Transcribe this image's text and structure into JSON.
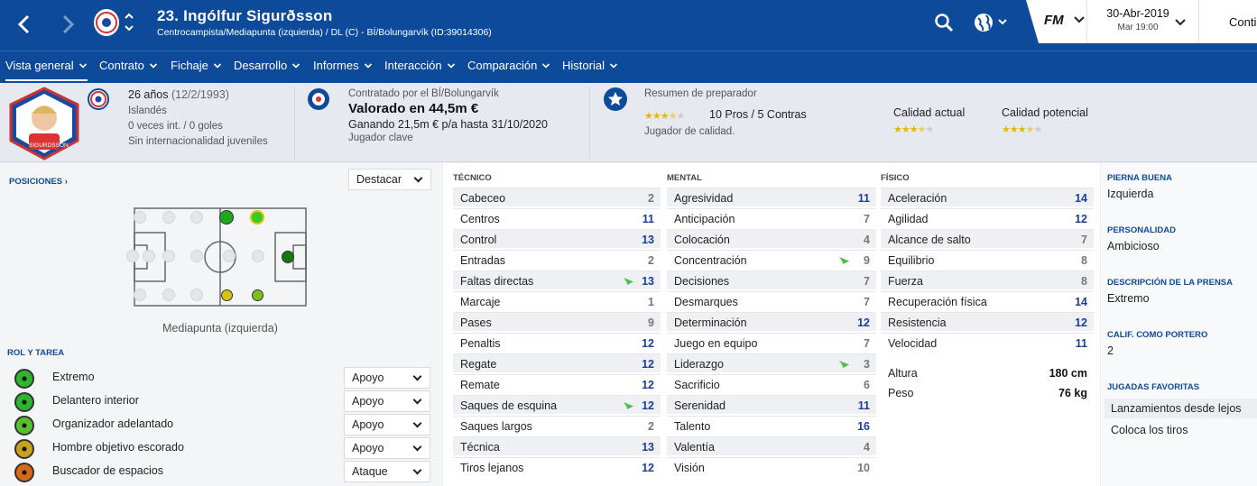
{
  "header": {
    "title": "23. Ingólfur Sigurðsson",
    "subtitle": "Centrocampista/Mediapunta (izquierda) / DL (C) - BÍ/Bolungarvík (ID:39014306)",
    "date": "30-Abr-2019",
    "time": "Mar 19:00",
    "fm": "FM",
    "continue": "Conti"
  },
  "menu": [
    "Vista general",
    "Contrato",
    "Fichaje",
    "Desarrollo",
    "Informes",
    "Interacción",
    "Comparación",
    "Historial"
  ],
  "info": {
    "age": "26 años",
    "dob": "(12/2/1993)",
    "nationality": "Islandés",
    "caps": "0 veces int. / 0 goles",
    "youth": "Sin internacionalidad juveniles",
    "contracted": "Contratado por el BÍ/Bolungarvík",
    "value": "Valorado en 44,5m €",
    "wage": "Ganando 21,5m € p/a hasta 31/10/2020",
    "status": "Jugador clave",
    "coach_title": "Resumen de preparador",
    "pros_cons": "10 Pros / 5 Contras",
    "coach_desc": "Jugador de calidad.",
    "current_ability": "Calidad actual",
    "potential_ability": "Calidad potencial",
    "photo_name": "SIGURDSSON"
  },
  "positions": {
    "title": "POSICIONES ›",
    "highlight": "Destacar",
    "selected": "Mediapunta (izquierda)"
  },
  "roles": {
    "title": "ROL Y TAREA",
    "items": [
      {
        "name": "Extremo",
        "duty": "Apoyo",
        "color": "#2db52d"
      },
      {
        "name": "Delantero interior",
        "duty": "Apoyo",
        "color": "#2db52d"
      },
      {
        "name": "Organizador adelantado",
        "duty": "Apoyo",
        "color": "#56c12a"
      },
      {
        "name": "Hombre objetivo escorado",
        "duty": "Apoyo",
        "color": "#c9a21a"
      },
      {
        "name": "Buscador de espacios",
        "duty": "Ataque",
        "color": "#d46a1a"
      }
    ]
  },
  "attributes": {
    "tecnico": {
      "title": "TÉCNICO",
      "items": [
        [
          "Cabeceo",
          2,
          ""
        ],
        [
          "Centros",
          11,
          ""
        ],
        [
          "Control",
          13,
          ""
        ],
        [
          "Entradas",
          2,
          ""
        ],
        [
          "Faltas directas",
          13,
          "up"
        ],
        [
          "Marcaje",
          1,
          ""
        ],
        [
          "Pases",
          9,
          ""
        ],
        [
          "Penaltis",
          12,
          ""
        ],
        [
          "Regate",
          12,
          ""
        ],
        [
          "Remate",
          12,
          ""
        ],
        [
          "Saques de esquina",
          12,
          "up"
        ],
        [
          "Saques largos",
          2,
          ""
        ],
        [
          "Técnica",
          13,
          ""
        ],
        [
          "Tiros lejanos",
          12,
          ""
        ]
      ]
    },
    "mental": {
      "title": "MENTAL",
      "items": [
        [
          "Agresividad",
          11,
          ""
        ],
        [
          "Anticipación",
          7,
          ""
        ],
        [
          "Colocación",
          4,
          ""
        ],
        [
          "Concentración",
          9,
          "up"
        ],
        [
          "Decisiones",
          7,
          ""
        ],
        [
          "Desmarques",
          7,
          ""
        ],
        [
          "Determinación",
          12,
          ""
        ],
        [
          "Juego en equipo",
          7,
          ""
        ],
        [
          "Liderazgo",
          3,
          "up"
        ],
        [
          "Sacrificio",
          6,
          ""
        ],
        [
          "Serenidad",
          11,
          ""
        ],
        [
          "Talento",
          16,
          ""
        ],
        [
          "Valentía",
          4,
          ""
        ],
        [
          "Visión",
          10,
          ""
        ]
      ]
    },
    "fisico": {
      "title": "FÍSICO",
      "items": [
        [
          "Aceleración",
          14,
          ""
        ],
        [
          "Agilidad",
          12,
          ""
        ],
        [
          "Alcance de salto",
          7,
          ""
        ],
        [
          "Equilibrio",
          8,
          ""
        ],
        [
          "Fuerza",
          8,
          ""
        ],
        [
          "Recuperación física",
          14,
          ""
        ],
        [
          "Resistencia",
          12,
          ""
        ],
        [
          "Velocidad",
          11,
          ""
        ]
      ]
    },
    "height_label": "Altura",
    "height": "180 cm",
    "weight_label": "Peso",
    "weight": "76 kg"
  },
  "right": {
    "foot_label": "PIERNA BUENA",
    "foot": "Izquierda",
    "pers_label": "PERSONALIDAD",
    "pers": "Ambicioso",
    "press_label": "DESCRIPCIÓN DE LA PRENSA",
    "press": "Extremo",
    "gk_label": "CALIF. COMO PORTERO",
    "gk": "2",
    "moves_label": "JUGADAS FAVORITAS",
    "moves": [
      "Lanzamientos desde lejos",
      "Coloca los tiros"
    ]
  }
}
